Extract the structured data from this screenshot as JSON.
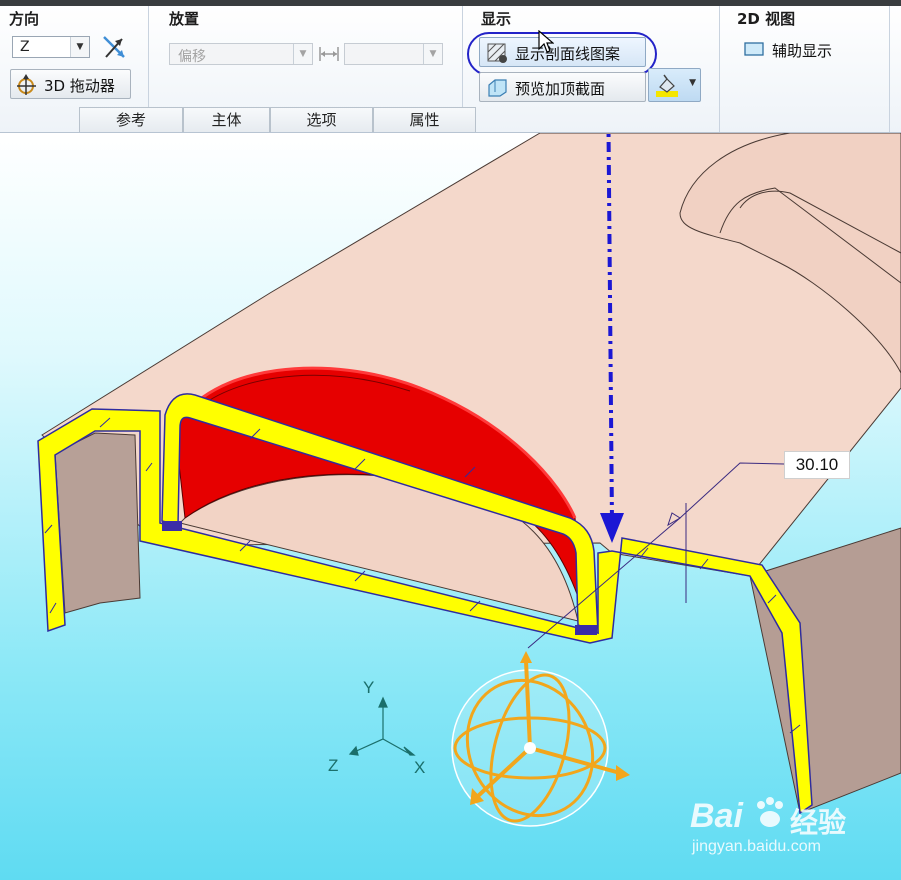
{
  "ribbon": {
    "direction": {
      "title": "方向",
      "axis_value": "Z",
      "drag_button": "3D 拖动器"
    },
    "placement": {
      "title": "放置",
      "offset_value": "偏移",
      "distance_value": ""
    },
    "display": {
      "title": "显示",
      "hatch_button": "显示剖面线图案",
      "preview_button": "预览加顶截面"
    },
    "view2d": {
      "title": "2D 视图",
      "aux_button": "辅助显示"
    },
    "tabs": [
      "参考",
      "主体",
      "选项",
      "属性"
    ]
  },
  "viewport": {
    "dimension": "30.10",
    "triad": {
      "x": "X",
      "y": "Y",
      "z": "Z"
    }
  },
  "watermark": {
    "brand": "Bai",
    "brand2": "经验",
    "url": "jingyan.baidu.com"
  },
  "colors": {
    "section_fill": "#ffff00",
    "section_edge": "#2f2ca0",
    "part": "#f4d8cb",
    "cut_red": "#e60000",
    "annotation": "#1b17d4"
  }
}
